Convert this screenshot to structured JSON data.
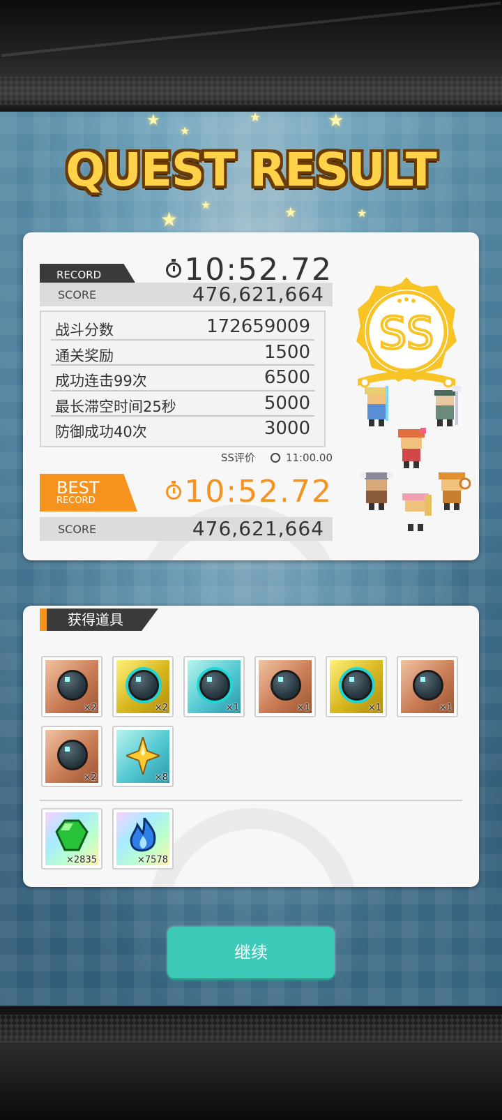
{
  "title": "QUEST RESULT",
  "record": {
    "tag": "RECORD",
    "time": "10:52.72",
    "score_label": "SCORE",
    "score": "476,621,664"
  },
  "details": [
    {
      "label": "战斗分数",
      "value": "172659009"
    },
    {
      "label": "通关奖励",
      "value": "1500"
    },
    {
      "label": "成功连击99次",
      "value": "6500"
    },
    {
      "label": "最长滞空时间25秒",
      "value": "5000"
    },
    {
      "label": "防御成功40次",
      "value": "3000"
    }
  ],
  "ss_rating": {
    "label": "SS评价",
    "time": "11:00.00"
  },
  "best": {
    "tag_line1": "BEST",
    "tag_line2": "RECORD",
    "time": "10:52.72",
    "score_label": "SCORE",
    "score": "476,621,664"
  },
  "rank": "SS",
  "items_section": {
    "label": "获得道具",
    "items": [
      {
        "icon": "dark-orb-icon",
        "count": "×2"
      },
      {
        "icon": "ringed-orb-icon",
        "count": "×2"
      },
      {
        "icon": "horned-orb-icon",
        "count": "×1"
      },
      {
        "icon": "dark-orb-icon",
        "count": "×1"
      },
      {
        "icon": "ringed-orb-icon",
        "count": "×1"
      },
      {
        "icon": "dark-orb-icon",
        "count": "×1"
      },
      {
        "icon": "dark-orb-icon",
        "count": "×2"
      },
      {
        "icon": "sparkle-star-icon",
        "count": "×8"
      }
    ],
    "currencies": [
      {
        "icon": "green-gem-icon",
        "count": "×2835"
      },
      {
        "icon": "blue-flame-icon",
        "count": "×7578"
      }
    ]
  },
  "continue_label": "继续",
  "colors": {
    "accent": "#f5931e",
    "button": "#3cc9b7",
    "rank": "#f7c325"
  }
}
